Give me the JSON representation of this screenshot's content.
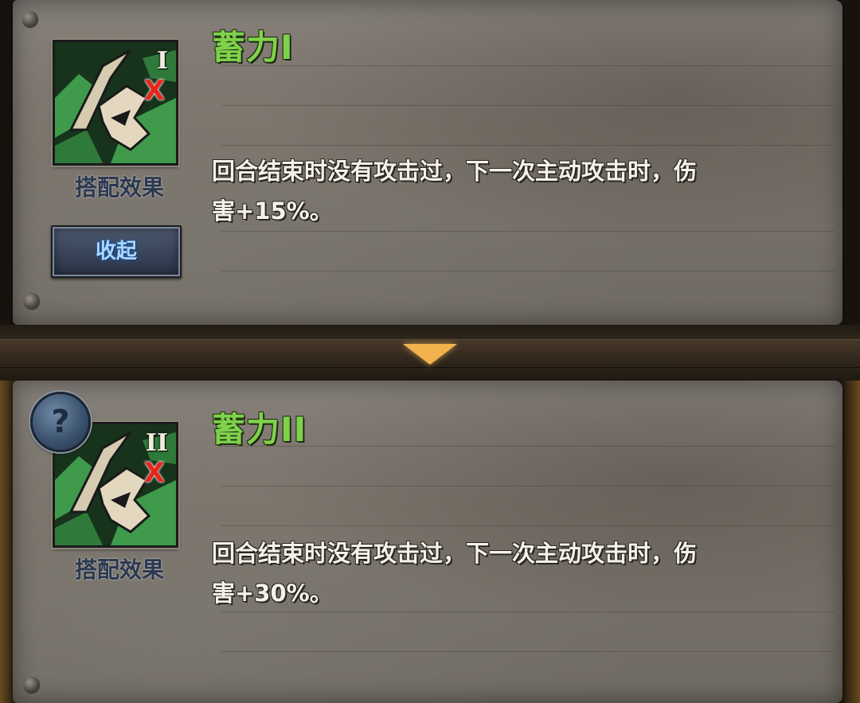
{
  "panels": [
    {
      "title": "蓄力I",
      "icon_level": "I",
      "icon_mark": "X",
      "icon": "charge-skill-icon",
      "caption": "搭配效果",
      "desc_line1": "回合结束时没有攻击过，下一次主动攻击时，伤",
      "desc_line2": "害+15%。"
    },
    {
      "title": "蓄力II",
      "icon_level": "II",
      "icon_mark": "X",
      "icon": "charge-skill-icon",
      "caption": "搭配效果",
      "desc_line1": "回合结束时没有攻击过，下一次主动攻击时，伤",
      "desc_line2": "害+30%。"
    }
  ],
  "buttons": {
    "collapse_label": "收起",
    "help_label": "?"
  },
  "icons": {
    "expand": "chevron-down-icon",
    "help": "question-icon"
  },
  "colors": {
    "title": "#7fd24a",
    "desc": "#f4f1ea",
    "caption": "#2b3852",
    "button_text": "#a9d8ff",
    "arrow": "#f2b24e",
    "x_mark": "#e8261e"
  }
}
